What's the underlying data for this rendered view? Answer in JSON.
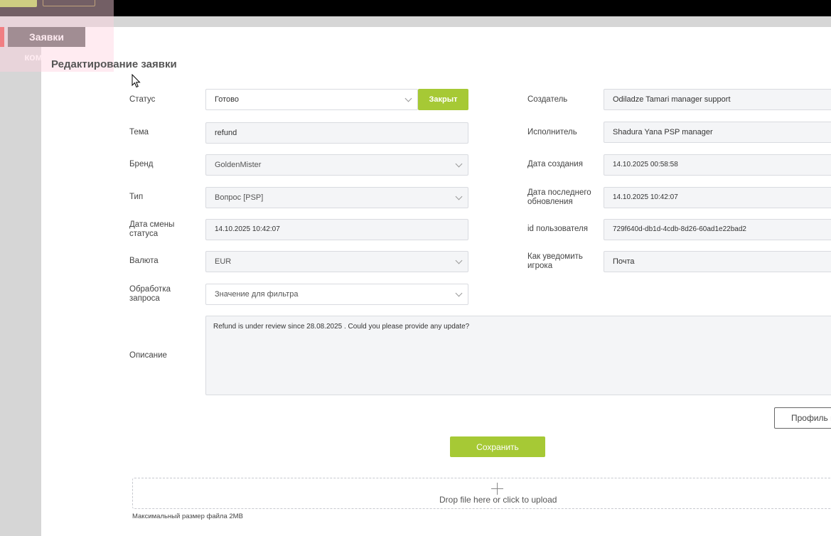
{
  "header": {
    "tab_label": "Заявки команды"
  },
  "form": {
    "title": "Редактирование заявки",
    "status": {
      "label": "Статус",
      "value": "Готово",
      "close_button": "Закрыт"
    },
    "topic": {
      "label": "Тема",
      "value": "refund"
    },
    "brand": {
      "label": "Бренд",
      "value": "GoldenMister"
    },
    "type": {
      "label": "Тип",
      "value": "Вопрос [PSP]"
    },
    "status_change_date": {
      "label_line1": "Дата смены",
      "label_line2": "статуса",
      "value": "14.10.2025 10:42:07"
    },
    "currency": {
      "label": "Валюта",
      "value": "EUR"
    },
    "processing": {
      "label_line1": "Обработка",
      "label_line2": "запроса",
      "placeholder": "Значение для фильтра"
    },
    "creator": {
      "label": "Создатель",
      "value": "Odiladze Tamari manager support"
    },
    "executor": {
      "label": "Исполнитель",
      "value": "Shadura Yana PSP manager"
    },
    "created_date": {
      "label": "Дата создания",
      "value": "14.10.2025 00:58:58"
    },
    "updated_date": {
      "label_line1": "Дата последнего",
      "label_line2": "обновления",
      "value": "14.10.2025 10:42:07"
    },
    "user_id": {
      "label": "id пользователя",
      "value": "729f640d-db1d-4cdb-8d26-60ad1e22bad2"
    },
    "notify": {
      "label_line1": "Как уведомить",
      "label_line2": "игрока",
      "value": "Почта"
    },
    "description": {
      "label": "Описание",
      "value": "Refund is under review since 28.08.2025 . Could you please provide any update?"
    },
    "profile_button": "Профиль и",
    "save_button": "Сохранить"
  },
  "upload": {
    "text": "Drop file here or click to upload",
    "hint": "Максимальный размер файла 2MB"
  },
  "colors": {
    "accent": "#a6c935",
    "tab": "#555555",
    "tab_marker": "#e53935"
  }
}
